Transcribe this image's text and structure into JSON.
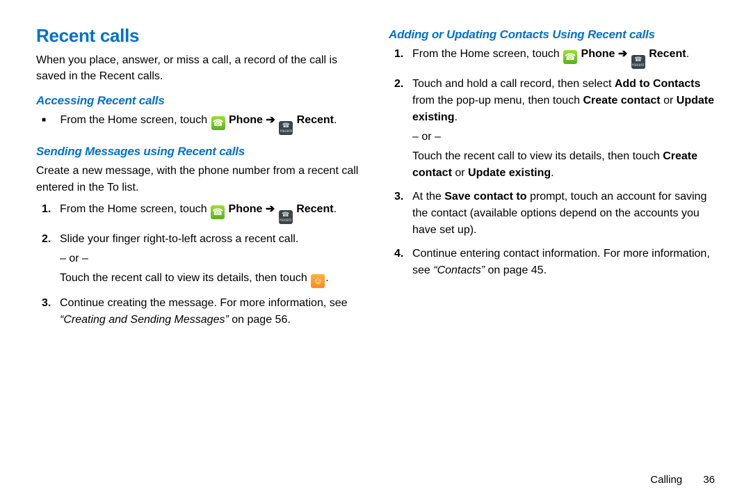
{
  "left": {
    "title": "Recent calls",
    "intro": "When you place, answer, or miss a call, a record of the call is saved in the Recent calls.",
    "sub1": "Accessing Recent calls",
    "sub1_bullet_pre": "From the Home screen, touch ",
    "phone_label": "Phone",
    "arrow": "➔",
    "recent_label": "Recent",
    "sub2": "Sending Messages using Recent calls",
    "sub2_intro": "Create a new message, with the phone number from a recent call entered in the To list.",
    "steps": {
      "s1_pre": "From the Home screen, touch ",
      "s2_a": "Slide your finger right-to-left across a recent call.",
      "or": "– or –",
      "s2_b": "Touch the recent call to view its details, then touch ",
      "s3_a": "Continue creating the message. For more information, see ",
      "s3_ref": "“Creating and Sending Messages”",
      "s3_c": " on page 56."
    }
  },
  "right": {
    "sub": "Adding or Updating Contacts Using Recent calls",
    "s1_pre": "From the Home screen, touch ",
    "phone_label": "Phone",
    "arrow": "➔",
    "recent_label": "Recent",
    "s2_a": "Touch and hold a call record, then select ",
    "s2_addto": "Add to Contacts",
    "s2_b": " from the pop-up menu, then touch ",
    "s2_create": "Create contact",
    "s2_or_word": " or ",
    "s2_update": "Update existing",
    "or": "– or –",
    "s2_c": "Touch the recent call to view its details, then touch ",
    "s3_a": "At the ",
    "s3_save": "Save contact to",
    "s3_b": " prompt, touch an account for saving the contact (available options depend on the accounts you have set up).",
    "s4_a": "Continue entering contact information. For more information, see ",
    "s4_ref": "“Contacts”",
    "s4_b": " on page 45."
  },
  "footer": {
    "chapter": "Calling",
    "page": "36"
  },
  "period": "."
}
